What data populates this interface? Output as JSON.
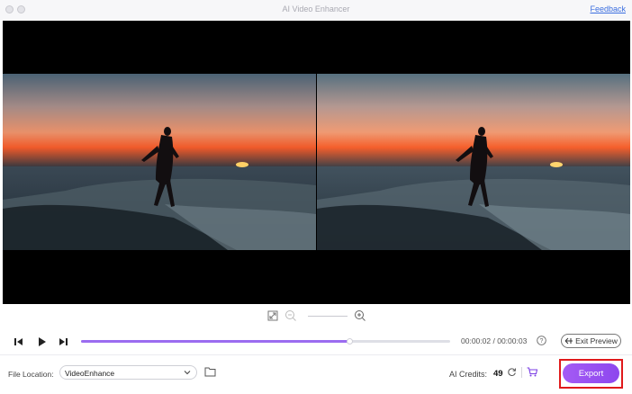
{
  "window": {
    "title": "AI Video Enhancer",
    "feedback_label": "Feedback"
  },
  "player": {
    "current_time": "00:00:02",
    "separator": "/",
    "total_time": "00:00:03",
    "progress_fraction": 0.73,
    "exit_preview_label": "Exit Preview",
    "exit_preview_icon": "exit-preview-icon"
  },
  "zoom": {
    "level_fraction": 0.5
  },
  "footer": {
    "file_location_label": "File Location:",
    "file_location_value": "VideoEnhance",
    "credits_label": "AI Credits:",
    "credits_value": "49",
    "export_label": "Export"
  },
  "colors": {
    "accent": "#9b6cf0",
    "highlight_frame": "#e0191b",
    "feedback_link": "#3c6fe0"
  }
}
